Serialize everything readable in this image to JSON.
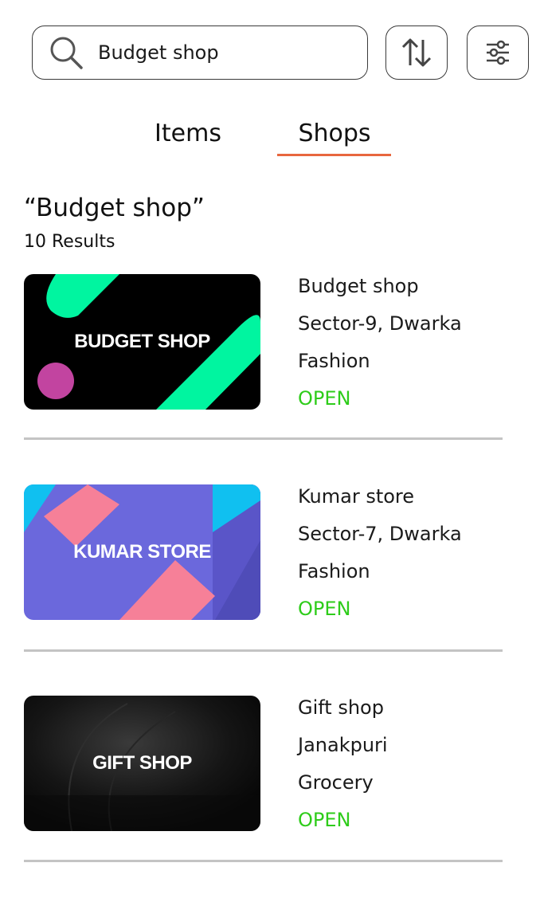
{
  "search": {
    "value": "Budget shop",
    "placeholder": ""
  },
  "toolbar": {
    "sort_icon": "sort-up-down-icon",
    "filter_icon": "filter-sliders-icon"
  },
  "tabs": [
    {
      "label": "Items",
      "active": false
    },
    {
      "label": "Shops",
      "active": true
    }
  ],
  "accent_color": "#e8673e",
  "results": {
    "query_title": "“Budget shop”",
    "count_text": "10 Results"
  },
  "shops": [
    {
      "thumb_label": "BUDGET SHOP",
      "name": "Budget shop",
      "location": "Sector-9, Dwarka",
      "category": "Fashion",
      "status": "OPEN"
    },
    {
      "thumb_label": "KUMAR STORE",
      "name": "Kumar store",
      "location": "Sector-7, Dwarka",
      "category": "Fashion",
      "status": "OPEN"
    },
    {
      "thumb_label": "GIFT SHOP",
      "name": "Gift shop",
      "location": "Janakpuri",
      "category": "Grocery",
      "status": "OPEN"
    }
  ],
  "status_color": "#2ecc1a"
}
